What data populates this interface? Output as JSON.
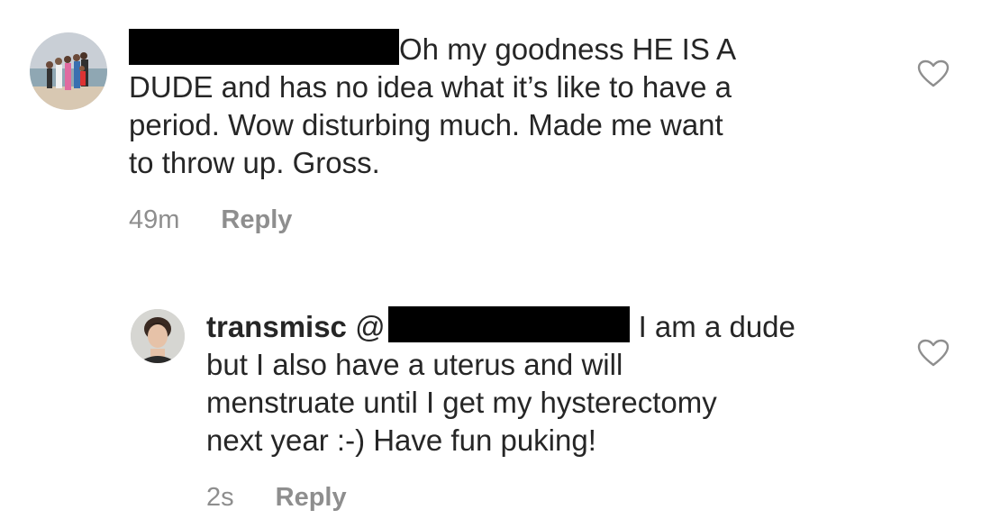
{
  "comments": [
    {
      "text_first_line": "Oh my goodness HE IS A",
      "text_rest": "DUDE and has no idea what it’s like to have a period. Wow disturbing much. Made me want to throw up. Gross.",
      "line2": "DUDE and has no idea what it’s like to have a",
      "line3": "period. Wow disturbing much. Made me want",
      "line4": "to throw up. Gross.",
      "time": "49m",
      "reply_label": "Reply",
      "like_icon": "heart-outline-icon"
    },
    {
      "username": "transmisc",
      "mention_prefix": "@",
      "line1_after": "I am a dude",
      "line2": "but I also have a uterus and will",
      "line3": "menstruate until I get my hysterectomy",
      "line4": "next year :-) Have fun puking!",
      "time": "2s",
      "reply_label": "Reply",
      "like_icon": "heart-outline-icon"
    }
  ],
  "colors": {
    "text": "#262626",
    "meta": "#8e8e8e",
    "redaction": "#000000"
  }
}
